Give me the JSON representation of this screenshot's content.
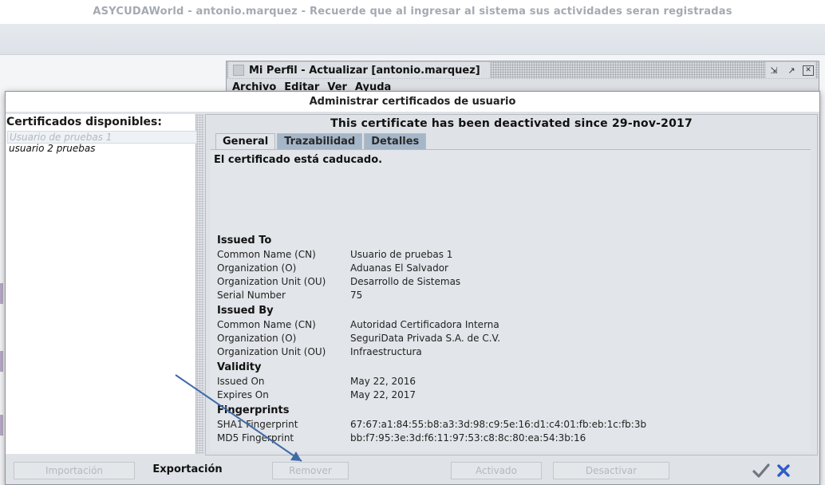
{
  "app": {
    "title": "ASYCUDAWorld - antonio.marquez - Recuerde que al ingresar al sistema sus actividades seran registradas"
  },
  "perfil_window": {
    "title": "Mi Perfil - Actualizar [antonio.marquez]",
    "menu": [
      "Archivo",
      "Editar",
      "Ver",
      "Ayuda"
    ],
    "buttons": {
      "restore": "⇲",
      "maximize": "↗",
      "close": "✕"
    }
  },
  "dialog": {
    "title": "Administrar certificados de usuario",
    "left": {
      "header": "Certificados disponibles:",
      "items": [
        "Usuario de pruebas 1",
        "usuario 2 pruebas"
      ]
    },
    "status": "This certificate has been deactivated since 29-nov-2017",
    "tabs": [
      "General",
      "Trazabilidad",
      "Detalles"
    ],
    "expired_message": "El certificado está caducado.",
    "issued_to": {
      "heading": "Issued To",
      "rows": [
        {
          "label": "Common Name (CN)",
          "value": "Usuario de pruebas 1"
        },
        {
          "label": "Organization (O)",
          "value": "Aduanas El Salvador"
        },
        {
          "label": "Organization Unit (OU)",
          "value": "Desarrollo de Sistemas"
        },
        {
          "label": "Serial Number",
          "value": "75"
        }
      ]
    },
    "issued_by": {
      "heading": "Issued By",
      "rows": [
        {
          "label": "Common Name (CN)",
          "value": "Autoridad Certificadora Interna"
        },
        {
          "label": "Organization (O)",
          "value": "SeguriData Privada S.A. de C.V."
        },
        {
          "label": "Organization Unit (OU)",
          "value": "Infraestructura"
        }
      ]
    },
    "validity": {
      "heading": "Validity",
      "rows": [
        {
          "label": "Issued On",
          "value": "May 22, 2016"
        },
        {
          "label": "Expires On",
          "value": "May 22, 2017"
        }
      ]
    },
    "fingerprints": {
      "heading": "Fingerprints",
      "rows": [
        {
          "label": "SHA1 Fingerprint",
          "value": "67:67:a1:84:55:b8:a3:3d:98:c9:5e:16:d1:c4:01:fb:eb:1c:fb:3b"
        },
        {
          "label": "MD5 Fingerprint",
          "value": "bb:f7:95:3e:3d:f6:11:97:53:c8:8c:80:ea:54:3b:16"
        }
      ]
    },
    "buttons": {
      "import": "Importación",
      "export": "Exportación",
      "remove": "Remover",
      "activate": "Activado",
      "deactivate": "Desactivar"
    }
  },
  "colors": {
    "arrow": "#3f6aa8",
    "ok_check": "#6f7780",
    "cancel_x": "#2e5cc8",
    "tab_inactive": "#a6b6c9"
  }
}
